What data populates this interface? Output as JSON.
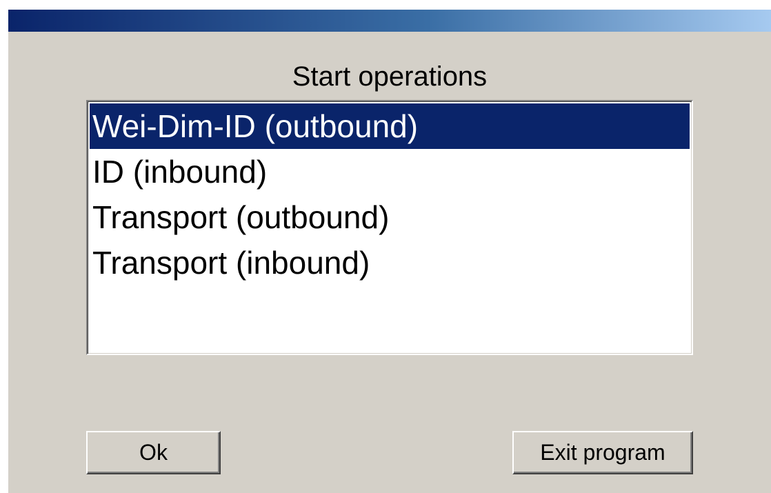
{
  "dialog": {
    "heading": "Start operations",
    "operations": [
      {
        "label": "Wei-Dim-ID (outbound)",
        "selected": true
      },
      {
        "label": "ID (inbound)",
        "selected": false
      },
      {
        "label": "Transport (outbound)",
        "selected": false
      },
      {
        "label": "Transport (inbound)",
        "selected": false
      }
    ],
    "ok_label": "Ok",
    "exit_label": "Exit program"
  }
}
